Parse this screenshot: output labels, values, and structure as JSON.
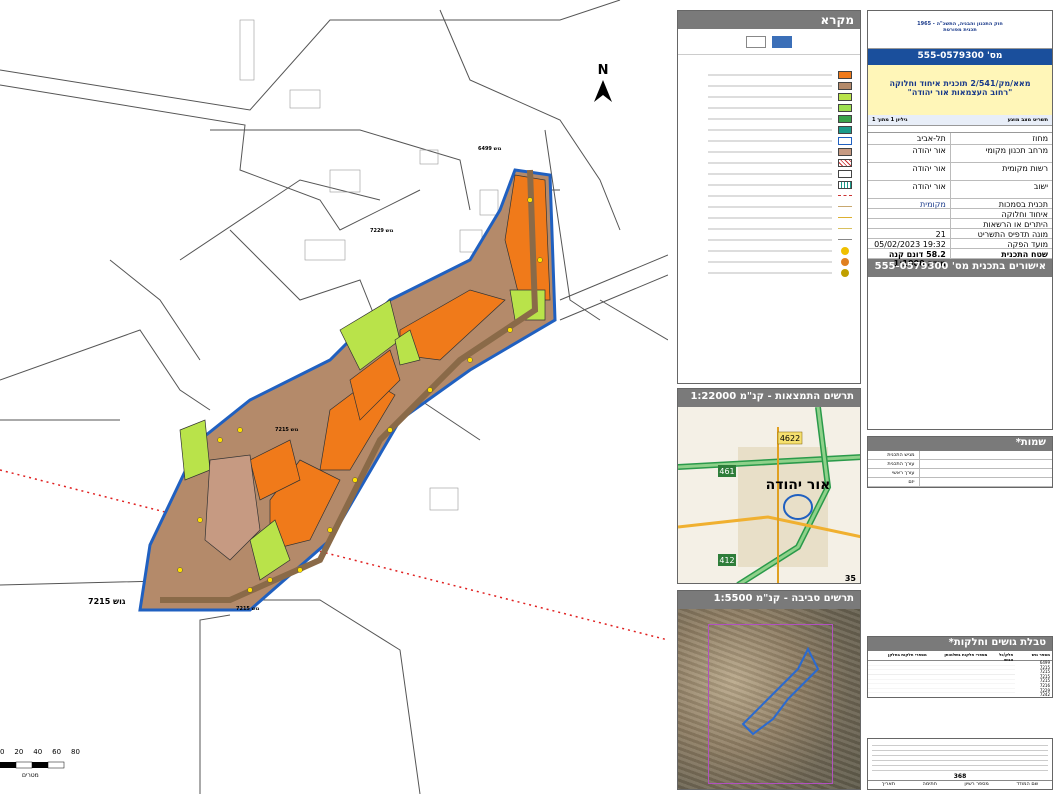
{
  "map": {
    "gush_6499": "גוש 6499",
    "gush_7229": "גוש 7229",
    "gush_7215_left": "גוש 7215",
    "gush_7215_center": "גוש 7215",
    "gush_7215_mid": "גוש 7215",
    "scale_ticks": [
      "0",
      "20",
      "40",
      "60",
      "80"
    ],
    "scale_unit": "מטרים",
    "north": "N"
  },
  "legend": {
    "title": "מקרא",
    "logo_text": "",
    "colors": {
      "orange": "#f07a1a",
      "brown": "#b48a6a",
      "lightgreen": "#b9e34a",
      "green": "#3aa34a",
      "teal": "#1b9b8a",
      "tan": "#c8a870",
      "blue": "#2060c0",
      "purple": "#9a2f9a"
    }
  },
  "title_block": {
    "law": "חוק התכנון והבניה, התשכ\"ה - 1965",
    "plan_type": "תכנית מפורטת",
    "plan_no_label": "מס'",
    "plan_no": "555-0579300",
    "plan_name_1": "מאא/מק/2/541 תוכנית איחוד וחלוקה",
    "plan_name_2": "\"רחוב העצמאות אור יהודה\"",
    "sheet": "תשריט מצב מוצע",
    "sheet_no": "גיליון 1 מתוך 1",
    "rows": [
      {
        "k": "מחוז",
        "v": "תל-אביב"
      },
      {
        "k": "מרחב תכנון מקומי",
        "v": "אור יהודה"
      },
      {
        "k": "רשות מקומית",
        "v": "אור יהודה"
      },
      {
        "k": "ישוב",
        "v": "אור יהודה"
      },
      {
        "k": "תכנית בסמכות",
        "v": "מקומית"
      },
      {
        "k": "איחוד וחלוקה",
        "v": ""
      },
      {
        "k": "היתרים או הרשאות",
        "v": ""
      },
      {
        "k": "מונה תדפיס התשריט",
        "v": "21"
      },
      {
        "k": "מועד הפקה",
        "v": "19:32   05/02/2023"
      },
      {
        "k": "שטח התכנית",
        "v": "58.2 דונם   קנה מידה 1:1000"
      }
    ],
    "approvals_label": "אישורים בתכנית מס'",
    "approvals_no": "555-0579300"
  },
  "inset1": {
    "title": "תרשים התמצאות - קנ\"מ 1:22000",
    "place": "אור יהודה",
    "road_a": "461",
    "road_b": "412",
    "road_c": "4622",
    "page": "35"
  },
  "inset2": {
    "title": "תרשים סביבה - קנ\"מ 1:5500"
  },
  "names": {
    "title": "שמות*",
    "rows": [
      "מגיש התכנית",
      "עורך התכנית",
      "עורך ראשי",
      "יזם"
    ]
  },
  "parcels": {
    "title": "טבלת גושים וחלקות*",
    "headers": [
      "מספר גוש",
      "חלק/כל הגוש",
      "מספרי חלקות בשלמותן",
      "מספרי חלקות בחלקן"
    ],
    "gushim": [
      "6499",
      "7215",
      "7215",
      "7215",
      "7215",
      "7216",
      "7229",
      "7242"
    ]
  },
  "footer": {
    "col1": "שם המודד",
    "col2": "מספר רשיון",
    "col3": "חתימה",
    "col4": "תאריך",
    "val": "368"
  }
}
